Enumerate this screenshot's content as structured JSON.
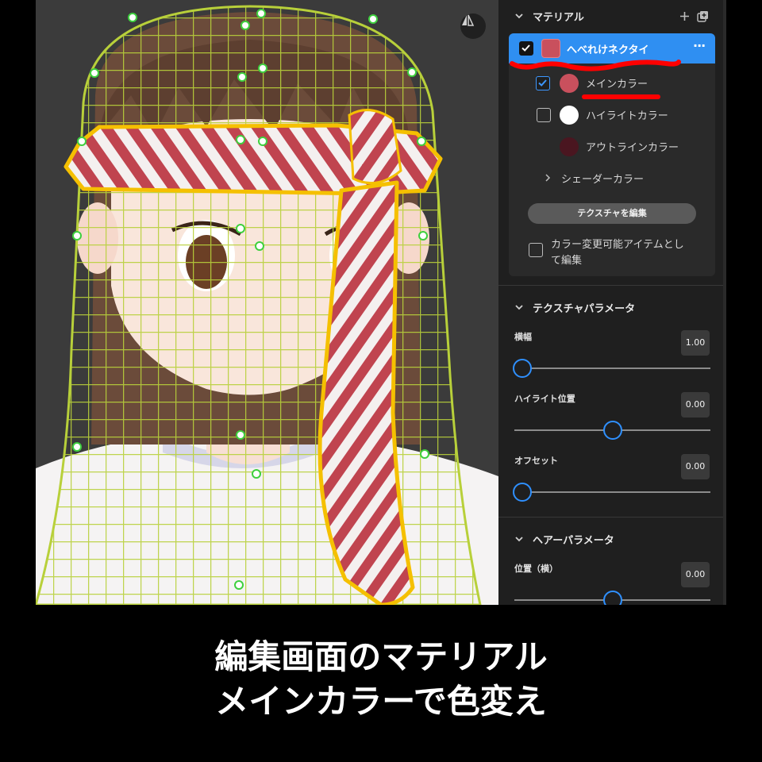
{
  "material_section": {
    "title": "マテリアル",
    "material_name": "へべれけネクタイ",
    "rows": [
      {
        "label": "メインカラー",
        "checked": true,
        "color": "#c9505d"
      },
      {
        "label": "ハイライトカラー",
        "checked": false,
        "color": "#ffffff"
      },
      {
        "label": "アウトラインカラー",
        "color": "#4a1620"
      }
    ],
    "shader_label": "シェーダーカラー",
    "texture_button": "テクスチャを編集",
    "colorable_label_line1": "カラー変更可能アイテムとし",
    "colorable_label_line2": "て編集"
  },
  "texture_params": {
    "title": "テクスチャパラメータ",
    "params": [
      {
        "label": "横幅",
        "value": "1.00",
        "fraction": 0.0
      },
      {
        "label": "ハイライト位置",
        "value": "0.00",
        "fraction": 0.5
      },
      {
        "label": "オフセット",
        "value": "0.00",
        "fraction": 0.0
      }
    ]
  },
  "hair_params": {
    "title": "ヘアーパラメータ",
    "params": [
      {
        "label": "位置（横）",
        "value": "0.00",
        "fraction": 0.5
      }
    ]
  },
  "caption": {
    "line1": "編集画面のマテリアル",
    "line2": "メインカラーで色変え"
  },
  "colors": {
    "accent": "#2f8ff2",
    "highlight_mark": "#ff0000",
    "wireframe": "#b8d03a",
    "outline": "#f5c000"
  }
}
